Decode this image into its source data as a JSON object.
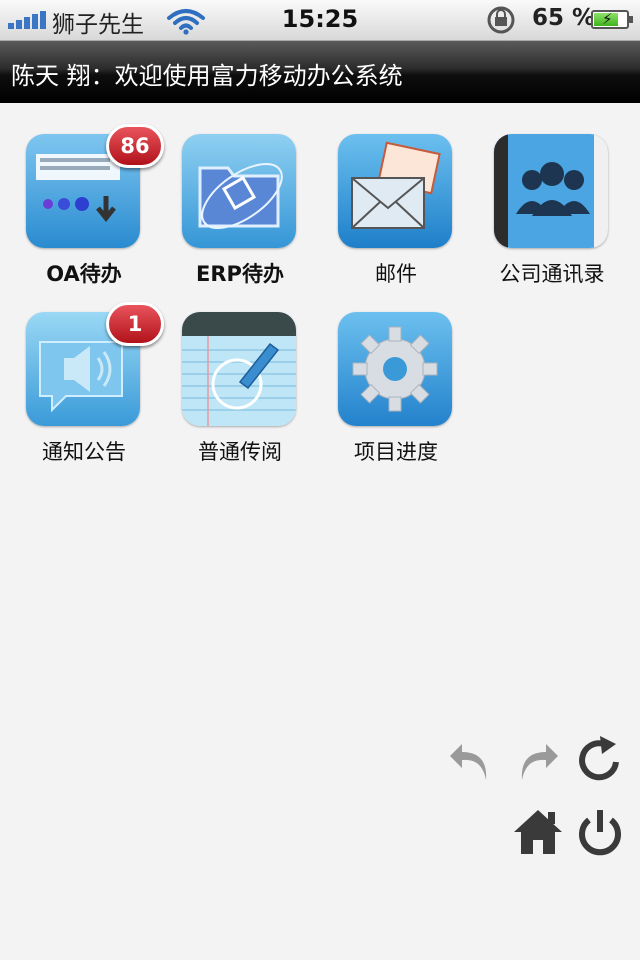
{
  "status_bar": {
    "carrier": "狮子先生",
    "time": "15:25",
    "battery_percent": "65 %",
    "signal_bars": 5,
    "battery_level": 0.7
  },
  "header": {
    "welcome": "陈天 翔：欢迎使用富力移动办公系统"
  },
  "apps": [
    {
      "label": "OA待办",
      "icon": "oa-todo-icon",
      "badge": "86"
    },
    {
      "label": "ERP待办",
      "icon": "erp-folder-icon"
    },
    {
      "label": "邮件",
      "icon": "mail-icon"
    },
    {
      "label": "公司通讯录",
      "icon": "contacts-icon"
    },
    {
      "label": "通知公告",
      "icon": "speaker-icon",
      "badge": "1"
    },
    {
      "label": "普通传阅",
      "icon": "notepad-pen-icon"
    },
    {
      "label": "项目进度",
      "icon": "gear-icon"
    }
  ],
  "controls": [
    "undo-icon",
    "redo-icon",
    "refresh-icon",
    "home-icon",
    "power-icon"
  ],
  "colors": {
    "badge": "#c21e26",
    "icon_blue": "#3c9ad8",
    "control_active": "#3a3a3a",
    "control_disabled": "#9a9a9a"
  }
}
